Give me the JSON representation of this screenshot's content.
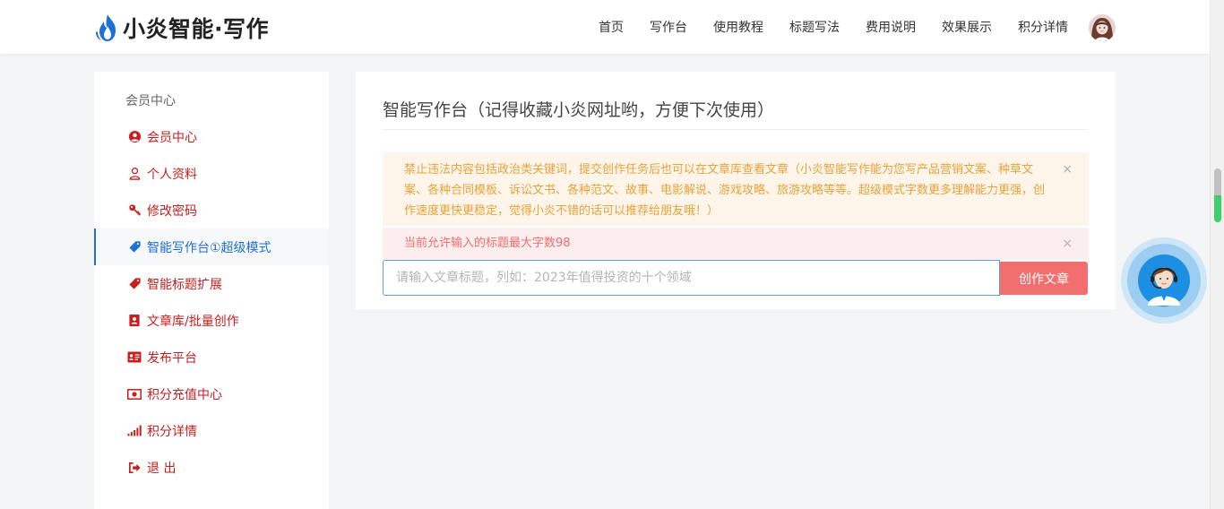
{
  "header": {
    "logo_text": "小炎智能·写作",
    "nav": [
      "首页",
      "写作台",
      "使用教程",
      "标题写法",
      "费用说明",
      "效果展示",
      "积分详情"
    ]
  },
  "sidebar": {
    "title": "会员中心",
    "items": [
      {
        "label": "会员中心",
        "icon": "user-circle-icon"
      },
      {
        "label": "个人资料",
        "icon": "user-icon"
      },
      {
        "label": "修改密码",
        "icon": "key-icon"
      },
      {
        "label": "智能写作台①超级模式",
        "icon": "tag-icon",
        "active": true
      },
      {
        "label": "智能标题扩展",
        "icon": "tag-icon"
      },
      {
        "label": "文章库/批量创作",
        "icon": "contact-book-icon"
      },
      {
        "label": "发布平台",
        "icon": "id-card-icon"
      },
      {
        "label": "积分充值中心",
        "icon": "money-icon"
      },
      {
        "label": "积分详情",
        "icon": "signal-icon"
      },
      {
        "label": "退 出",
        "icon": "sign-out-icon"
      }
    ]
  },
  "main": {
    "title": "智能写作台（记得收藏小炎网址哟，方便下次使用）",
    "notice": "禁止违法内容包括政治类关键词，提交创作任务后也可以在文章库查看文章（小炎智能写作能为您写产品营销文案、种草文案、各种合同模板、诉讼文书、各种范文、故事、电影解说、游戏攻略、旅游攻略等等。超级模式字数更多理解能力更强，创作速度更快更稳定，觉得小炎不错的话可以推荐给朋友哦！）",
    "limit_notice": "当前允许输入的标题最大字数98",
    "input_value": "",
    "input_placeholder": "请输入文章标题，列如：2023年值得投资的十个领域",
    "submit_label": "创作文章",
    "close_symbol": "×"
  },
  "colors": {
    "accent_blue": "#1e6fd6",
    "menu_red": "#c81e1e",
    "warn_text": "#e8a33a",
    "error_text": "#ef6e6e",
    "button_red": "#f26f6f"
  }
}
